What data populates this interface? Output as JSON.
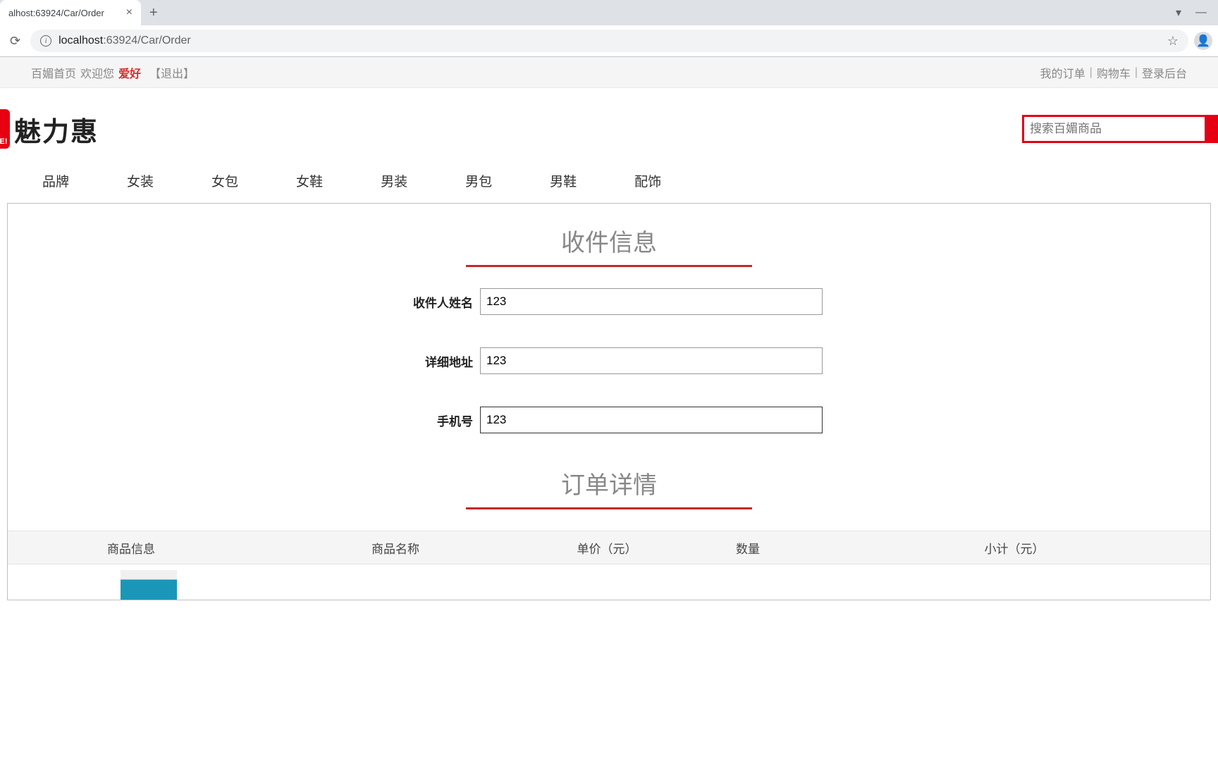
{
  "browser": {
    "tab_title": "alhost:63924/Car/Order",
    "url_host": "localhost",
    "url_rest": ":63924/Car/Order"
  },
  "top_bar": {
    "home_link": "百媚首页",
    "welcome": "欢迎您",
    "username": "爱好",
    "logout": "【退出】",
    "my_orders": "我的订单",
    "cart": "购物车",
    "admin_login": "登录后台"
  },
  "logo": {
    "badge": "E!",
    "text": "魅力惠"
  },
  "search": {
    "placeholder": "搜索百媚商品"
  },
  "nav": {
    "items": [
      "品牌",
      "女装",
      "女包",
      "女鞋",
      "男装",
      "男包",
      "男鞋",
      "配饰"
    ]
  },
  "sections": {
    "recipient_title": "收件信息",
    "order_title": "订单详情"
  },
  "form": {
    "name_label": "收件人姓名",
    "name_value": "123",
    "address_label": "详细地址",
    "address_value": "123",
    "phone_label": "手机号",
    "phone_value": "123"
  },
  "table": {
    "col_info": "商品信息",
    "col_name": "商品名称",
    "col_price": "单价（元）",
    "col_qty": "数量",
    "col_subtotal": "小计（元）"
  }
}
